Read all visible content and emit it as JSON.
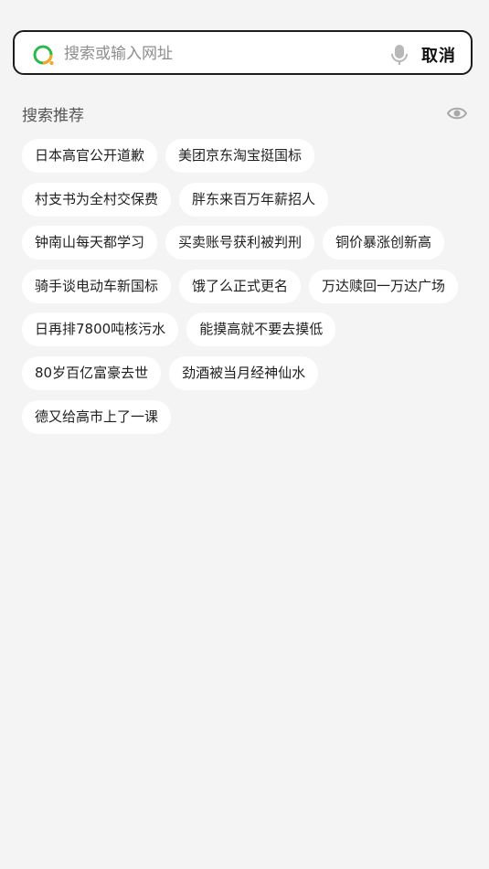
{
  "search": {
    "placeholder": "搜索或输入网址",
    "value": "",
    "cancel_label": "取消",
    "logo_icon": "browser-logo-icon",
    "mic_icon": "microphone-icon"
  },
  "recommend": {
    "title": "搜索推荐",
    "visibility_icon": "eye-icon",
    "rows": [
      [
        "日本高官公开道歉",
        "美团京东淘宝挺国标"
      ],
      [
        "村支书为全村交保费",
        "胖东来百万年薪招人"
      ],
      [
        "钟南山每天都学习",
        "买卖账号获利被判刑",
        "铜价暴涨创新高"
      ],
      [
        "骑手谈电动车新国标",
        "饿了么正式更名",
        "万达赎回一万达广场"
      ],
      [
        "日再排7800吨核污水",
        "能摸高就不要去摸低"
      ],
      [
        "80岁百亿富豪去世",
        "劲酒被当月经神仙水"
      ],
      [
        "德又给高市上了一课"
      ]
    ]
  },
  "colors": {
    "background": "#f4f4f4",
    "tag_background": "#ffffff",
    "logo_green": "#2db84d",
    "logo_orange": "#f5a623",
    "search_border": "#1c1c1c"
  }
}
